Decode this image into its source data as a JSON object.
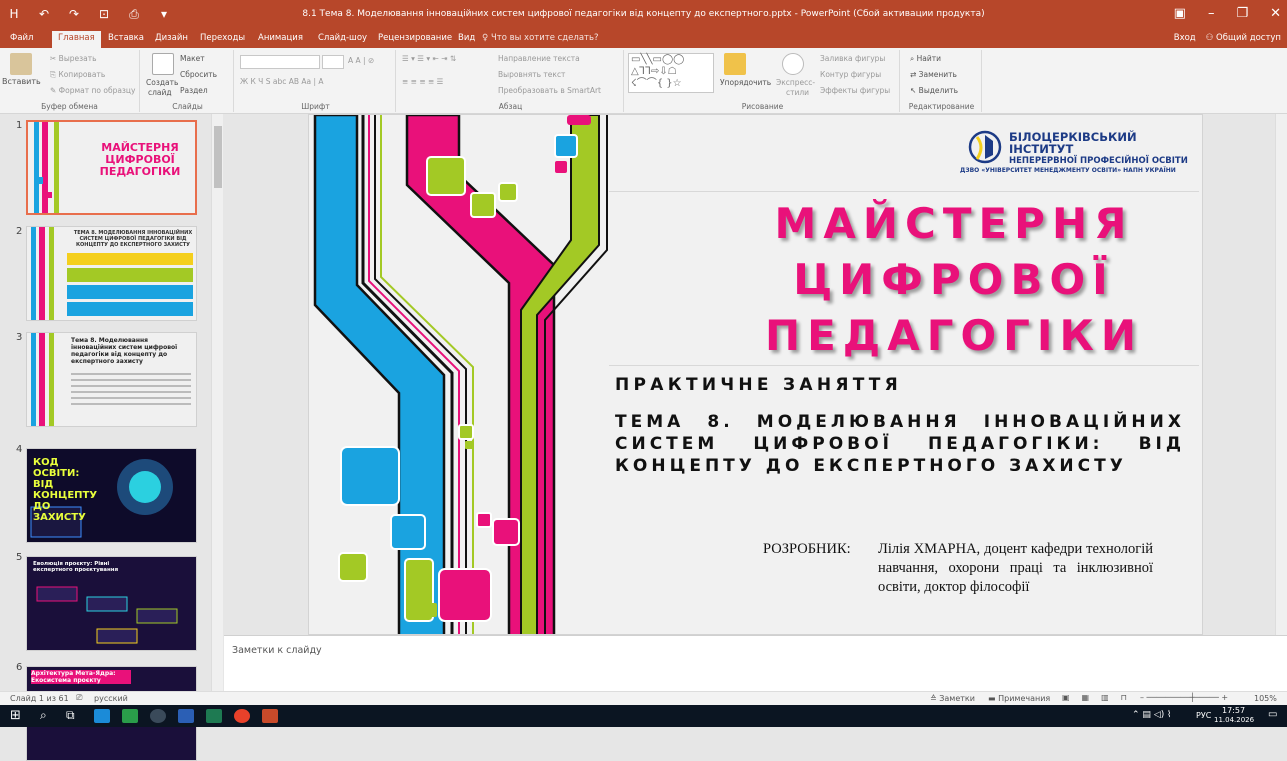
{
  "window": {
    "title": "8.1 Тема 8. Моделювання інноваційних систем цифрової педагогіки від концепту до експертного.pptx - PowerPoint (Сбой активации продукта)",
    "qat": [
      "H",
      "↶",
      "↷",
      "⊡",
      "⎙",
      "▾"
    ],
    "controls": [
      "▣",
      "–",
      "❐",
      "✕"
    ]
  },
  "tabs": [
    "Файл",
    "Главная",
    "Вставка",
    "Дизайн",
    "Переходы",
    "Анимация",
    "Слайд-шоу",
    "Рецензирование",
    "Вид"
  ],
  "active_tab": "Главная",
  "tell_me": "Что вы хотите сделать?",
  "account": {
    "signin": "Вход",
    "share": "Общий доступ"
  },
  "ribbon": {
    "clipboard": {
      "paste": "Вставить",
      "cut": "Вырезать",
      "copy": "Копировать",
      "format_painter": "Формат по образцу",
      "label": "Буфер обмена"
    },
    "slides": {
      "new_slide": "Создать",
      "new_slide2": "слайд",
      "layout": "Макет",
      "reset": "Сбросить",
      "section": "Раздел",
      "label": "Слайды"
    },
    "font": {
      "label": "Шрифт",
      "fmt": "Ж  К  Ч  S  abc  АВ  Aa  |  A",
      "size_grow": "A  A  |  ⊘"
    },
    "paragraph": {
      "direction": "Направление текста",
      "align": "Выровнять текст",
      "smartart": "Преобразовать в SmartArt",
      "label": "Абзац"
    },
    "drawing": {
      "arrange": "Упорядочить",
      "quick_styles": "Экспресс-",
      "quick_styles2": "стили",
      "fill": "Заливка фигуры",
      "outline": "Контур фигуры",
      "effects": "Эффекты фигуры",
      "label": "Рисование"
    },
    "editing": {
      "find": "Найти",
      "replace": "Заменить",
      "select": "Выделить",
      "label": "Редактирование"
    }
  },
  "thumbnails": [
    {
      "num": "1",
      "title": "МАЙСТЕРНЯ ЦИФРОВОЇ ПЕДАГОГІКИ"
    },
    {
      "num": "2",
      "title": "ТЕМА 8. МОДЕЛЮВАННЯ ІННОВАЦІЙНИХ СИСТЕМ ЦИФРОВОЇ ПЕДАГОГІКИ ВІД КОНЦЕПТУ ДО ЕКСПЕРТНОГО ЗАХИСТУ"
    },
    {
      "num": "3",
      "title": "Тема 8. Моделювання інноваційних систем цифрової педагогіки від концепту до експертного захисту"
    },
    {
      "num": "4",
      "title": "КОД ОСВІТИ: ВІД КОНЦЕПТУ ДО ЗАХИСТУ"
    },
    {
      "num": "5",
      "title": "Еволюція проєкту: Рівні експертного проєктування"
    },
    {
      "num": "6",
      "title": "Архітектура Мета-Ядра: Екосистема проєкту"
    }
  ],
  "slide": {
    "institute": [
      "БІЛОЦЕРКІВСЬКИЙ ІНСТИТУТ",
      "НЕПЕРЕРВНОЇ ПРОФЕСІЙНОЇ ОСВІТИ"
    ],
    "institute_sub": "ДЗВО «УНІВЕРСИТЕТ МЕНЕДЖМЕНТУ ОСВІТИ» НАПН УКРАЇНИ",
    "title_lines": [
      "МАЙСТЕРНЯ",
      "ЦИФРОВОЇ",
      "ПЕДАГОГІКИ"
    ],
    "subtitle": "ПРАКТИЧНЕ ЗАНЯТТЯ",
    "topic": "ТЕМА 8. МОДЕЛЮВАННЯ ІННОВАЦІЙНИХ СИСТЕМ ЦИФРОВОЇ ПЕДАГОГІКИ: ВІД КОНЦЕПТУ ДО ЕКСПЕРТНОГО ЗАХИСТУ",
    "developer_label": "РОЗРОБНИК:",
    "developer": "Лілія ХМАРНА, доцент кафедри технологій навчання, охорони праці та інклюзивної освіти, доктор філософії"
  },
  "notes_placeholder": "Заметки к слайду",
  "status": {
    "slide_of": "Слайд 1 из 61",
    "language": "русский",
    "notes": "Заметки",
    "comments": "Примечания",
    "zoom": "105%"
  },
  "taskbar": {
    "time": "17:57",
    "date": "11.04.2026",
    "lang": "РУС"
  },
  "colors": {
    "accent": "#b7472a",
    "pink": "#e9117a",
    "cyan": "#1aa3e0",
    "lime": "#a3c925",
    "title_shadow": "#000000"
  }
}
